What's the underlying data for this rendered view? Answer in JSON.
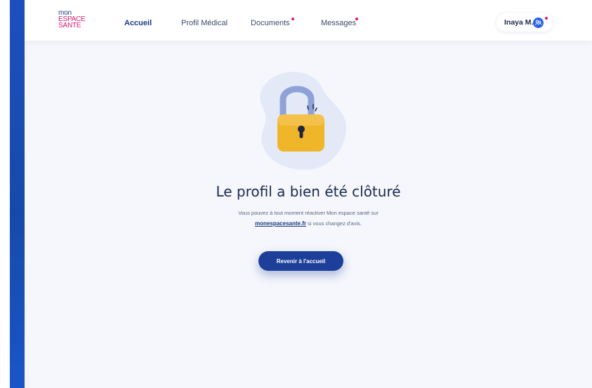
{
  "logo": {
    "line1": "mon",
    "line2": "ESPACE",
    "line3": "SANTE"
  },
  "nav": {
    "items": [
      {
        "label": "Accueil",
        "active": true,
        "notification": false
      },
      {
        "label": "Profil Médical",
        "active": false,
        "notification": false
      },
      {
        "label": "Documents",
        "active": false,
        "notification": true
      },
      {
        "label": "Messages",
        "active": false,
        "notification": true
      }
    ]
  },
  "user": {
    "name": "Inaya M.",
    "notification": true,
    "icon": "user-switch-icon"
  },
  "main": {
    "illustration": "padlock-icon",
    "title": "Le profil a bien été clôturé",
    "message_part1": "Vous pouvez à tout moment réactiver Mon espace santé sur",
    "link_text": "monespacesante.fr",
    "message_part2": " si vous changez d'avis.",
    "button_label": "Revenir à l'accueil"
  },
  "colors": {
    "brand_blue": "#1d3f99",
    "brand_pink": "#d81b70",
    "sidebar_blue": "#1d4fbf",
    "lock_yellow": "#f0b62a",
    "lock_shackle": "#8ea2d8",
    "page_background": "#f5f7fc"
  }
}
